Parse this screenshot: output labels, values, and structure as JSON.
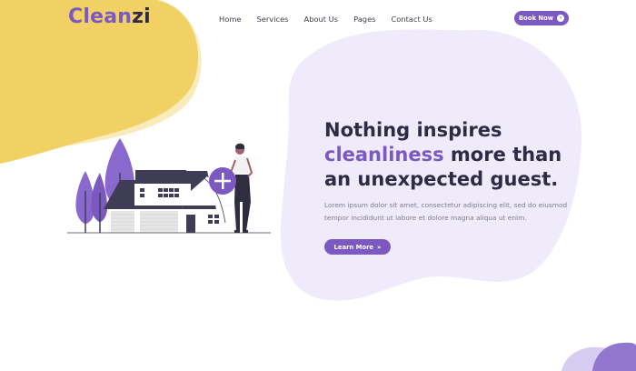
{
  "brand": {
    "logo_part1": "Clean",
    "logo_part2": "zi"
  },
  "nav": {
    "items": [
      "Home",
      "Services",
      "About Us",
      "Pages",
      "Contact Us"
    ]
  },
  "header": {
    "book_label": "Book Now",
    "book_icon": "arrow-circle-icon"
  },
  "hero": {
    "title_line1": "Nothing inspires",
    "title_highlight": "cleanliness",
    "title_line2_rest": " more than",
    "title_line3": "an unexpected guest.",
    "description": "Lorem ipsum dolor sit amet, consectetur adipiscing elit, sed do eiusmod tempor incididunt ut labore et dolore magna aliqua ut enim.",
    "cta_label": "Learn More",
    "cta_icon": "double-chevron-right-icon"
  },
  "colors": {
    "primary": "#7b59c0",
    "accent_yellow": "#f1d164",
    "blob_lavender": "#efebfb",
    "heading": "#2f2b45",
    "body_text": "#7c7a8f"
  }
}
